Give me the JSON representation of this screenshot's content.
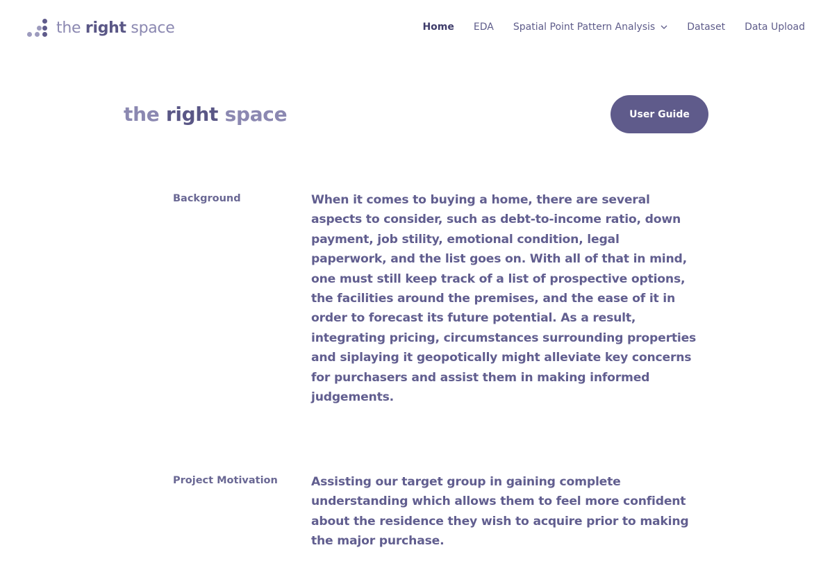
{
  "header": {
    "logo": {
      "light_a": "the ",
      "bold": "right",
      "light_b": " space"
    },
    "nav": [
      {
        "label": "Home",
        "active": true
      },
      {
        "label": "EDA"
      },
      {
        "label": "Spatial Point Pattern Analysis",
        "icon": "chevron-down-icon"
      },
      {
        "label": "Dataset"
      },
      {
        "label": "Data Upload"
      }
    ]
  },
  "hero": {
    "title": {
      "light_a": "the ",
      "bold": "right",
      "light_b": " space"
    },
    "button_label": "User Guide"
  },
  "sections": [
    {
      "label": "Background",
      "text": "When it comes to buying a home, there are several aspects to consider, such as debt-to-income ratio, down payment, job stility, emotional condition, legal paperwork, and the list goes on. With all of that in mind, one must still keep track of a list of prospective options, the facilities around the premises, and the ease of it in order to forecast its future potential. As a result, integrating pricing, circumstances surrounding properties and siplaying it geopotically might alleviate key concerns for purchasers and assist them in making informed judgements."
    },
    {
      "label": "Project Motivation",
      "text": "Assisting our target group in gaining complete understanding which allows them to feel more confident about the residence they wish to acquire prior to making the major purchase."
    }
  ],
  "colors": {
    "accent": "#5f5b8b",
    "text": "#615e8f",
    "logo_light": "#8b88b1",
    "logo_dot_dark": "#5f5b8b",
    "logo_dot_light": "#9d9bbe"
  }
}
